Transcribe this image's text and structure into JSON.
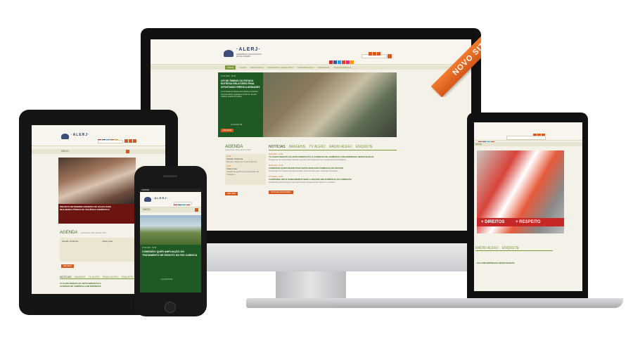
{
  "brand": {
    "logo": "·ALERJ·",
    "logo_sub": "ASSEMBLEIA LEGISLATIVA DO RIO DE JANEIRO",
    "ribbon": "NOVO SITE",
    "colors": {
      "green": "#7c9a3a",
      "darkgreen": "#1f5a24",
      "orange": "#d45a1e",
      "cream": "#f3f1e8"
    }
  },
  "desktop": {
    "nav": [
      "INÍCIO",
      "ALERJ",
      "DEPUTADOS",
      "PROCESSO LEGISLATIVO",
      "COMUNICAÇÃO",
      "CIDADANIA",
      "TRANSPARÊNCIA"
    ],
    "slide": {
      "date": "07.04.2016 · 19:35",
      "headline": "CPI DE ÔNIBUS DO ESTADO ENTREGA RELATÓRIO FINAL APONTANDO IRREGULARIDADES",
      "body": "A Comissão de Defesa dos Direitos da Mulher da Assembleia Legislativa do Rio de Janeiro realizou audiência pública...",
      "more": "LEIA MAIS",
      "dots": [
        "1",
        "2",
        "3",
        "4",
        "5",
        "6",
        "7",
        "8"
      ]
    },
    "agenda": {
      "title": "AGENDA",
      "date": "quarta-feira, 08 de abril de 2016",
      "items": [
        {
          "time": "10:00",
          "label": "Sessão Ordinária",
          "sub": "Plenário Barbosa Lima Sobrinho"
        },
        {
          "time": "14:00",
          "label": "Vidas praia",
          "sub": "Audiência pública da Comissão de Trabalho..."
        }
      ],
      "more": "VER MAIS"
    },
    "tabs": [
      "NOTÍCIAS",
      "IMAGENS",
      "TV ALERJ",
      "RÁDIO ALERJ",
      "ENQUETE"
    ],
    "news": [
      {
        "date": "08.04.2016 · 14:00",
        "title": "TV ALERJ DEBATE OS ANTICORRUPÇÃO E ACORDOS DE LENIÊNCIA COM EMPRESAS INVESTIGADAS",
        "body": "Programa de entrevistas discute acordos de leniência com empresas investigadas..."
      },
      {
        "date": "08.04.2016 · 12:00",
        "title": "COMISSÃO QUER INCENTIVAR ARTES MARCIAIS CHINESAS NO ESTADO",
        "body": "Comissão de Cultura da Alerj debate incentivo às artes marciais chinesas..."
      },
      {
        "date": "07.04.2016 · 19:00",
        "title": "CAMPANHA PELO SANEAMENTO SERÁ LANÇADA EM AUDIÊNCIA DA COMISSÃO",
        "body": "Audiência pública lança campanha pelo saneamento básico no estado..."
      }
    ],
    "news_more": "NOTÍCIAS ANTERIORES"
  },
  "tablet": {
    "nav": "INÍCIO",
    "slide_headline": "PROJETO DETERMINA RESERVA DE VAGAS PARA MULHERES VÍTIMAS DE VIOLÊNCIA DOMÉSTICA",
    "agenda_title": "AGENDA",
    "agenda_date": "quarta-feira, 08 de abril de 2016",
    "agenda_items": [
      "Sessão Ordinária",
      "Vidas praia"
    ],
    "more": "VER MAIS",
    "tabs": [
      "NOTÍCIAS",
      "IMAGENS",
      "TV ALERJ",
      "RÁDIO ALERJ",
      "ENQUETE"
    ],
    "news_title": "TV ALERJ DEBATE OS ANTICORRUPÇÃO E ACORDOS DE LENIÊNCIA COM EMPRESAS"
  },
  "phone": {
    "status": "CARRIER",
    "nav": "INÍCIO",
    "date": "07.04.2016 · 19:35",
    "headline": "COMISSÃO QUER AMPLIAÇÃO DO TRATAMENTO DE ESGOTO NO RIO CARIOCA",
    "dots": [
      "1",
      "2",
      "3",
      "4",
      "5",
      "6",
      "7",
      "8"
    ]
  },
  "laptop": {
    "banner_left": "+ DIREITOS",
    "banner_right": "+ RESPEITO",
    "tabs": [
      "RÁDIO ALERJ",
      "ENQUETE"
    ],
    "news_title": "...DA COM EMPRESAS INVESTIGADAS",
    "nav": "INÍCIO"
  }
}
